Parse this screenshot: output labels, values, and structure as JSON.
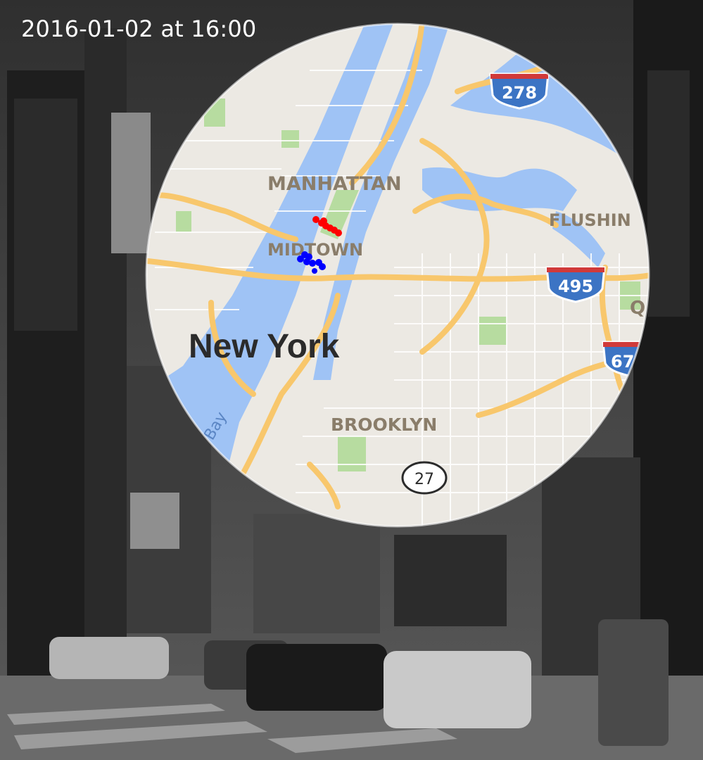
{
  "timestamp": "2016-01-02 at 16:00",
  "map": {
    "labels": {
      "city": "New York",
      "manhattan": "MANHATTAN",
      "midtown": "MIDTOWN",
      "brooklyn": "BROOKLYN",
      "flushing": "FLUSHIN",
      "queens_partial": "Q",
      "bay_partial": "Bay"
    },
    "shields": {
      "i278": "278",
      "i495": "495",
      "i678_partial": "67",
      "route27": "27"
    },
    "clusters": [
      {
        "name": "red",
        "color": "#ff0000",
        "count": 7
      },
      {
        "name": "blue",
        "color": "#0000ff",
        "count": 8
      }
    ]
  },
  "colors": {
    "water": "#9fc3f5",
    "land": "#ece9e3",
    "park": "#b7dca0",
    "highway": "#f8c76c",
    "road": "#ffffff"
  }
}
